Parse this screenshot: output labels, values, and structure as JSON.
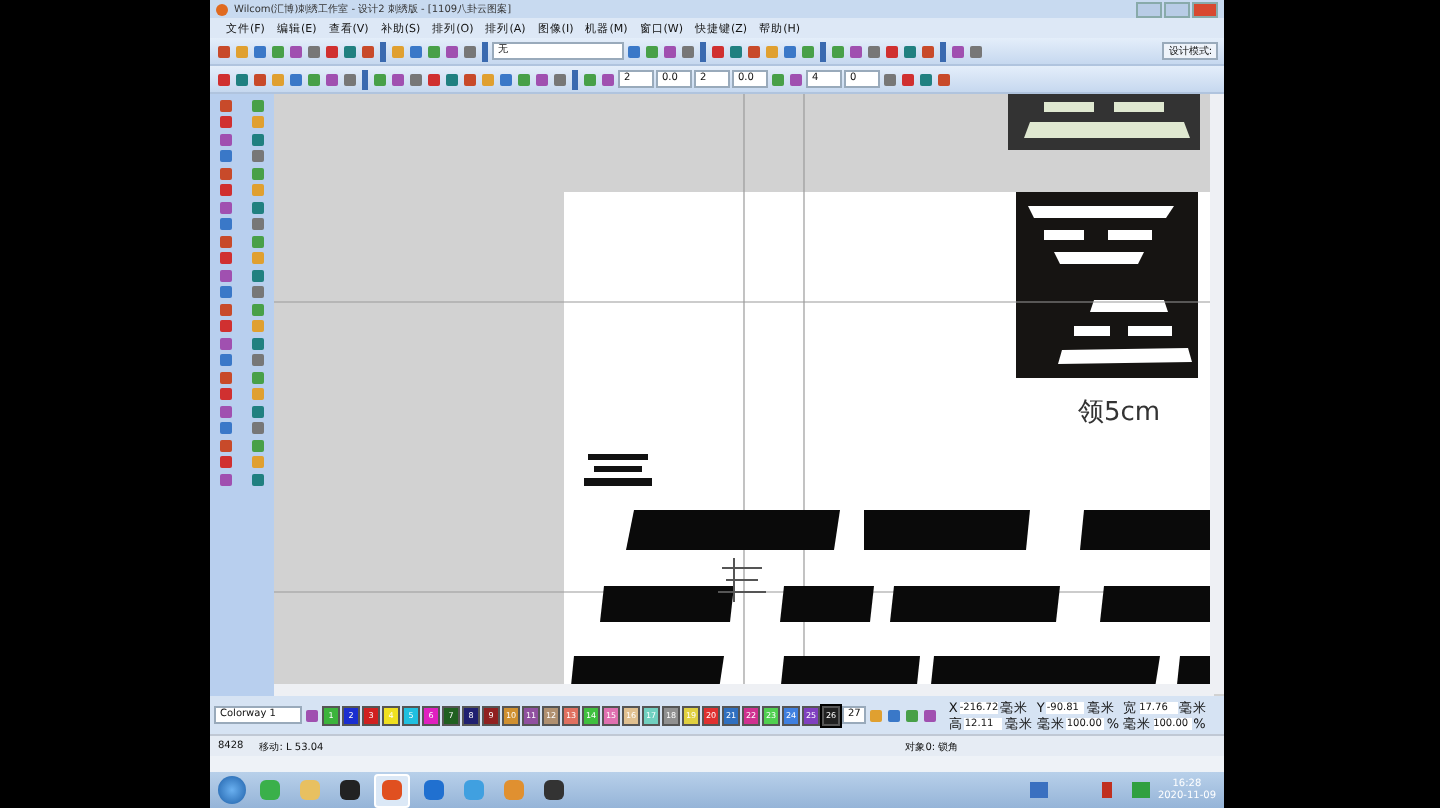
{
  "window": {
    "title": "Wilcom(汇博)刺绣工作室 - 设计2 刺绣版 - [1109八卦云图案]"
  },
  "menu": [
    "文件(F)",
    "编辑(E)",
    "查看(V)",
    "补助(S)",
    "排列(O)",
    "排列(A)",
    "图像(I)",
    "机器(M)",
    "窗口(W)",
    "快捷键(Z)",
    "帮助(H)"
  ],
  "toolbar": {
    "stitch_field": {
      "value": "无"
    },
    "design_mode": "设计模式:",
    "numbers": [
      "2",
      "0.0",
      "2",
      "0.0",
      "4",
      "0"
    ]
  },
  "canvas": {
    "label": "领5cm"
  },
  "colorway": {
    "value": "Colorway 1",
    "swatches": [
      {
        "label": "1",
        "color": "#3cb43c",
        "selected": false
      },
      {
        "label": "2",
        "color": "#1a2ed0",
        "selected": false
      },
      {
        "label": "3",
        "color": "#d02020",
        "selected": false
      },
      {
        "label": "4",
        "color": "#f0e020",
        "selected": false
      },
      {
        "label": "5",
        "color": "#20c0e0",
        "selected": false
      },
      {
        "label": "6",
        "color": "#e020c0",
        "selected": false
      },
      {
        "label": "7",
        "color": "#206020",
        "selected": false
      },
      {
        "label": "8",
        "color": "#202070",
        "selected": false
      },
      {
        "label": "9",
        "color": "#902020",
        "selected": false
      },
      {
        "label": "10",
        "color": "#d09030",
        "selected": false
      },
      {
        "label": "11",
        "color": "#9050a0",
        "selected": false
      },
      {
        "label": "12",
        "color": "#b09070",
        "selected": false
      },
      {
        "label": "13",
        "color": "#e07060",
        "selected": false
      },
      {
        "label": "14",
        "color": "#40c040",
        "selected": false
      },
      {
        "label": "15",
        "color": "#e070b0",
        "selected": false
      },
      {
        "label": "16",
        "color": "#e0c090",
        "selected": false
      },
      {
        "label": "17",
        "color": "#70d0c0",
        "selected": false
      },
      {
        "label": "18",
        "color": "#909090",
        "selected": false
      },
      {
        "label": "19",
        "color": "#e0d040",
        "selected": false
      },
      {
        "label": "20",
        "color": "#e03030",
        "selected": false
      },
      {
        "label": "21",
        "color": "#3070c0",
        "selected": false
      },
      {
        "label": "22",
        "color": "#d03090",
        "selected": false
      },
      {
        "label": "23",
        "color": "#50d050",
        "selected": false
      },
      {
        "label": "24",
        "color": "#4080e0",
        "selected": false
      },
      {
        "label": "25",
        "color": "#8040c0",
        "selected": false
      },
      {
        "label": "26",
        "color": "#202020",
        "selected": true
      }
    ],
    "count": "27"
  },
  "coordinates": [
    {
      "label": "X",
      "value": "-216.72",
      "unit": "毫米"
    },
    {
      "label": "Y",
      "value": "-90.81",
      "unit": "毫米"
    },
    {
      "label": "宽",
      "value": "17.76",
      "unit": "毫米"
    },
    {
      "label": "高",
      "value": "12.11",
      "unit": "毫米"
    },
    {
      "label": "毫米",
      "value": "100.00",
      "unit": "%"
    },
    {
      "label": "毫米",
      "value": "100.00",
      "unit": "%"
    }
  ],
  "status_bar": [
    "8428",
    "移动: L 53.04",
    "对象0: 锁角"
  ],
  "taskbar": {
    "time": "16:28",
    "date": "2020-11-09"
  }
}
